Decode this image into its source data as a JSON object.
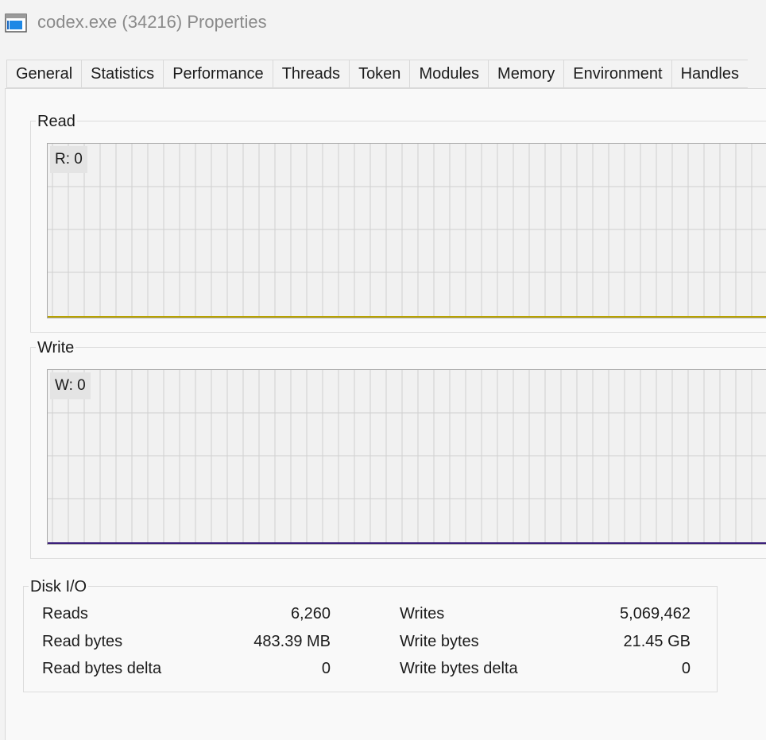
{
  "window": {
    "title": "codex.exe (34216) Properties",
    "icon": "window-icon"
  },
  "tabs": [
    {
      "label": "General"
    },
    {
      "label": "Statistics"
    },
    {
      "label": "Performance"
    },
    {
      "label": "Threads"
    },
    {
      "label": "Token"
    },
    {
      "label": "Modules"
    },
    {
      "label": "Memory"
    },
    {
      "label": "Environment"
    },
    {
      "label": "Handles"
    }
  ],
  "read_group": {
    "title": "Read",
    "overlay": "R: 0",
    "line_color": "#b8a200"
  },
  "write_group": {
    "title": "Write",
    "overlay": "W: 0",
    "line_color": "#3a1f7a"
  },
  "disk_io": {
    "title": "Disk I/O",
    "reads_label": "Reads",
    "reads_value": "6,260",
    "read_bytes_label": "Read bytes",
    "read_bytes_value": "483.39 MB",
    "read_bytes_delta_label": "Read bytes delta",
    "read_bytes_delta_value": "0",
    "writes_label": "Writes",
    "writes_value": "5,069,462",
    "write_bytes_label": "Write bytes",
    "write_bytes_value": "21.45 GB",
    "write_bytes_delta_label": "Write bytes delta",
    "write_bytes_delta_value": "0"
  }
}
